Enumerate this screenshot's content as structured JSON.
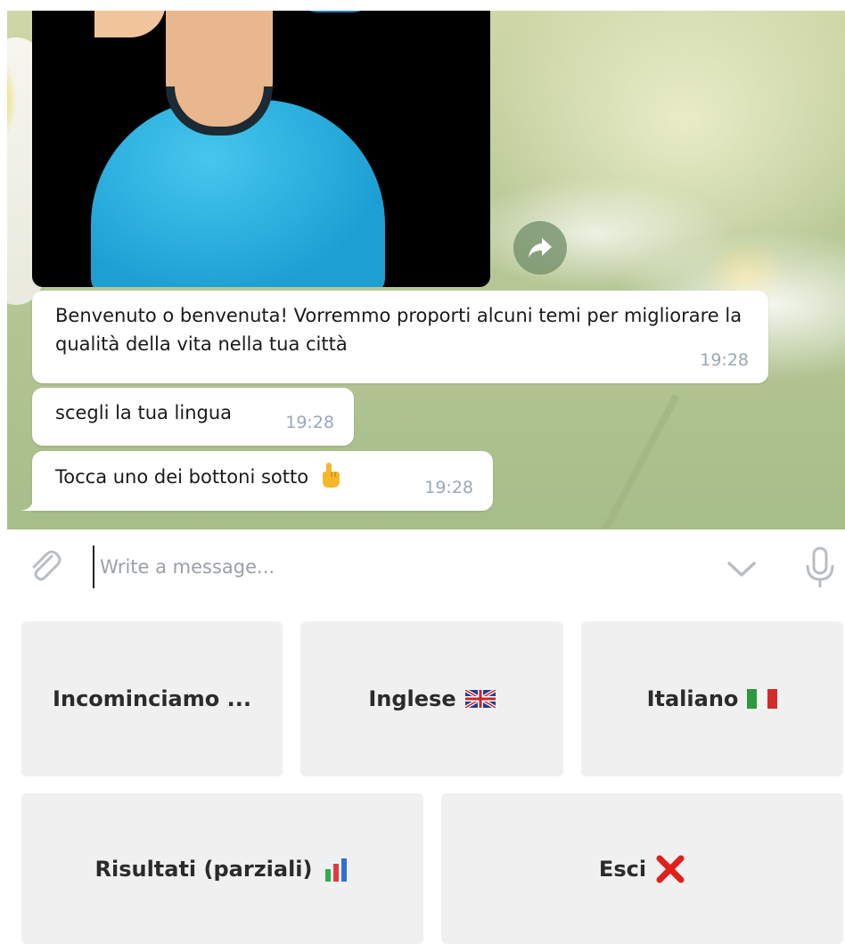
{
  "chat": {
    "messages": [
      {
        "text": "Benvenuto o benvenuta! Vorremmo proporti alcuni temi per migliorare la qualità della vita nella tua città",
        "time": "19:28"
      },
      {
        "text": "scegli la tua lingua",
        "time": "19:28"
      },
      {
        "text": "Tocca uno dei bottoni sotto",
        "time": "19:28",
        "emoji_icon": "pointing-up-hand-icon"
      }
    ]
  },
  "composer": {
    "placeholder": "Write a message..."
  },
  "keyboard": {
    "buttons": [
      {
        "label": "Incominciamo ..."
      },
      {
        "label": "Inglese",
        "icon": "uk-flag-icon"
      },
      {
        "label": "Italiano",
        "icon": "italy-flag-icon"
      },
      {
        "label": "Risultati (parziali)",
        "icon": "bar-chart-icon"
      },
      {
        "label": "Esci",
        "icon": "red-x-icon"
      }
    ]
  },
  "colors": {
    "keyboard_button_bg": "#f0f0f0",
    "bubble_bg": "#ffffff",
    "timestamp": "#9aa8b4",
    "exit_x": "#e0201b"
  }
}
